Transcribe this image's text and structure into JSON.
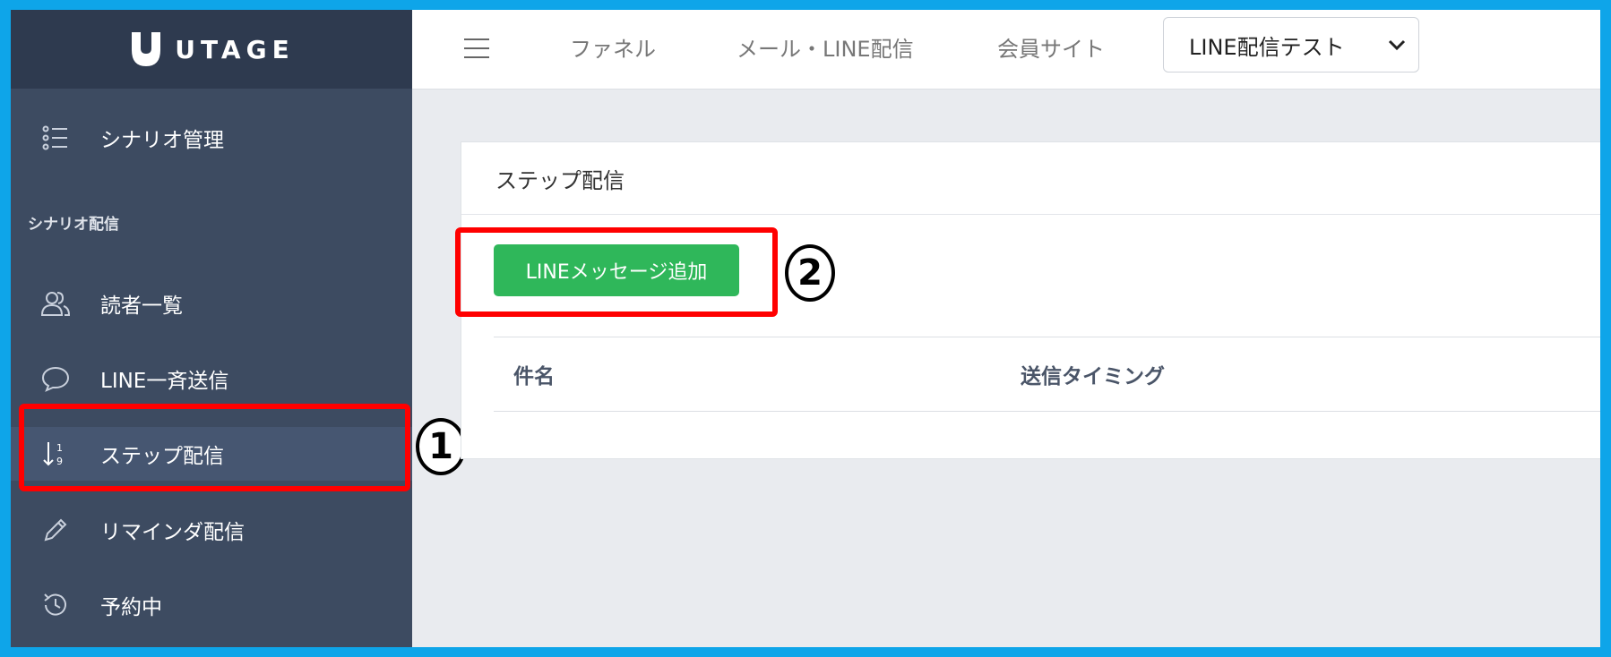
{
  "brand": {
    "name": "UTAGE"
  },
  "topnav": {
    "links": [
      "ファネル",
      "メール・LINE配信",
      "会員サイト"
    ],
    "select_value": "LINE配信テスト"
  },
  "sidebar": {
    "top_item": {
      "label": "シナリオ管理",
      "icon": "list-icon"
    },
    "section_label": "シナリオ配信",
    "items": [
      {
        "label": "読者一覧",
        "icon": "users-icon"
      },
      {
        "label": "LINE一斉送信",
        "icon": "chat-bubble-icon"
      },
      {
        "label": "ステップ配信",
        "icon": "sort-numeric-icon",
        "active": true
      },
      {
        "label": "リマインダ配信",
        "icon": "pencil-icon"
      },
      {
        "label": "予約中",
        "icon": "history-icon"
      }
    ]
  },
  "main": {
    "card_title": "ステップ配信",
    "add_button": "LINEメッセージ追加",
    "table_headers": [
      "件名",
      "送信タイミング"
    ]
  },
  "annotations": {
    "step1": "1",
    "step2": "2"
  },
  "colors": {
    "highlight": "#ff0000",
    "button": "#2fb75a",
    "sidebar": "#3d4b61"
  }
}
